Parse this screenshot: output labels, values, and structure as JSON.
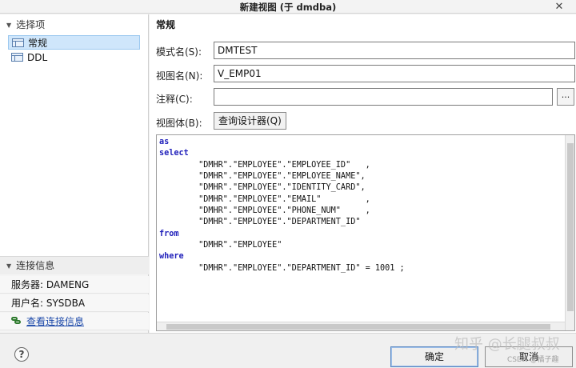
{
  "window": {
    "title": "新建视图 (于 dmdba)",
    "close_glyph": "✕"
  },
  "sidebar": {
    "section_label": "选择项",
    "items": [
      {
        "label": "常规"
      },
      {
        "label": "DDL"
      }
    ]
  },
  "connection": {
    "section_label": "连接信息",
    "server": "服务器: DAMENG",
    "user": "用户名: SYSDBA",
    "link": "查看连接信息"
  },
  "form": {
    "pane_title": "常规",
    "schema_label": "模式名(S):",
    "schema_value": "DMTEST",
    "view_label": "视图名(N):",
    "view_value": "V_EMP01",
    "comment_label": "注释(C):",
    "comment_value": "",
    "comment_btn": "...",
    "body_label": "视图体(B):",
    "designer_btn": "查询设计器(Q)"
  },
  "sql": [
    {
      "kw": "as",
      "text": ""
    },
    {
      "kw": "select",
      "text": ""
    },
    {
      "kw": "",
      "text": "        \"DMHR\".\"EMPLOYEE\".\"EMPLOYEE_ID\"   ,"
    },
    {
      "kw": "",
      "text": "        \"DMHR\".\"EMPLOYEE\".\"EMPLOYEE_NAME\","
    },
    {
      "kw": "",
      "text": "        \"DMHR\".\"EMPLOYEE\".\"IDENTITY_CARD\","
    },
    {
      "kw": "",
      "text": "        \"DMHR\".\"EMPLOYEE\".\"EMAIL\"         ,"
    },
    {
      "kw": "",
      "text": "        \"DMHR\".\"EMPLOYEE\".\"PHONE_NUM\"     ,"
    },
    {
      "kw": "",
      "text": "        \"DMHR\".\"EMPLOYEE\".\"DEPARTMENT_ID\""
    },
    {
      "kw": "from",
      "text": ""
    },
    {
      "kw": "",
      "text": "        \"DMHR\".\"EMPLOYEE\""
    },
    {
      "kw": "where",
      "text": ""
    },
    {
      "kw": "",
      "text": "        \"DMHR\".\"EMPLOYEE\".\"DEPARTMENT_ID\" = 1001 ;"
    }
  ],
  "footer": {
    "help": "?",
    "ok": "确定",
    "cancel": "取消"
  },
  "watermark": {
    "main": "知乎 @长腿叔叔",
    "csdn": "CSDN @橘子趣"
  },
  "colors": {
    "keyword": "#2222bb",
    "link": "#1a47a8",
    "selection": "#cfe6fb"
  }
}
